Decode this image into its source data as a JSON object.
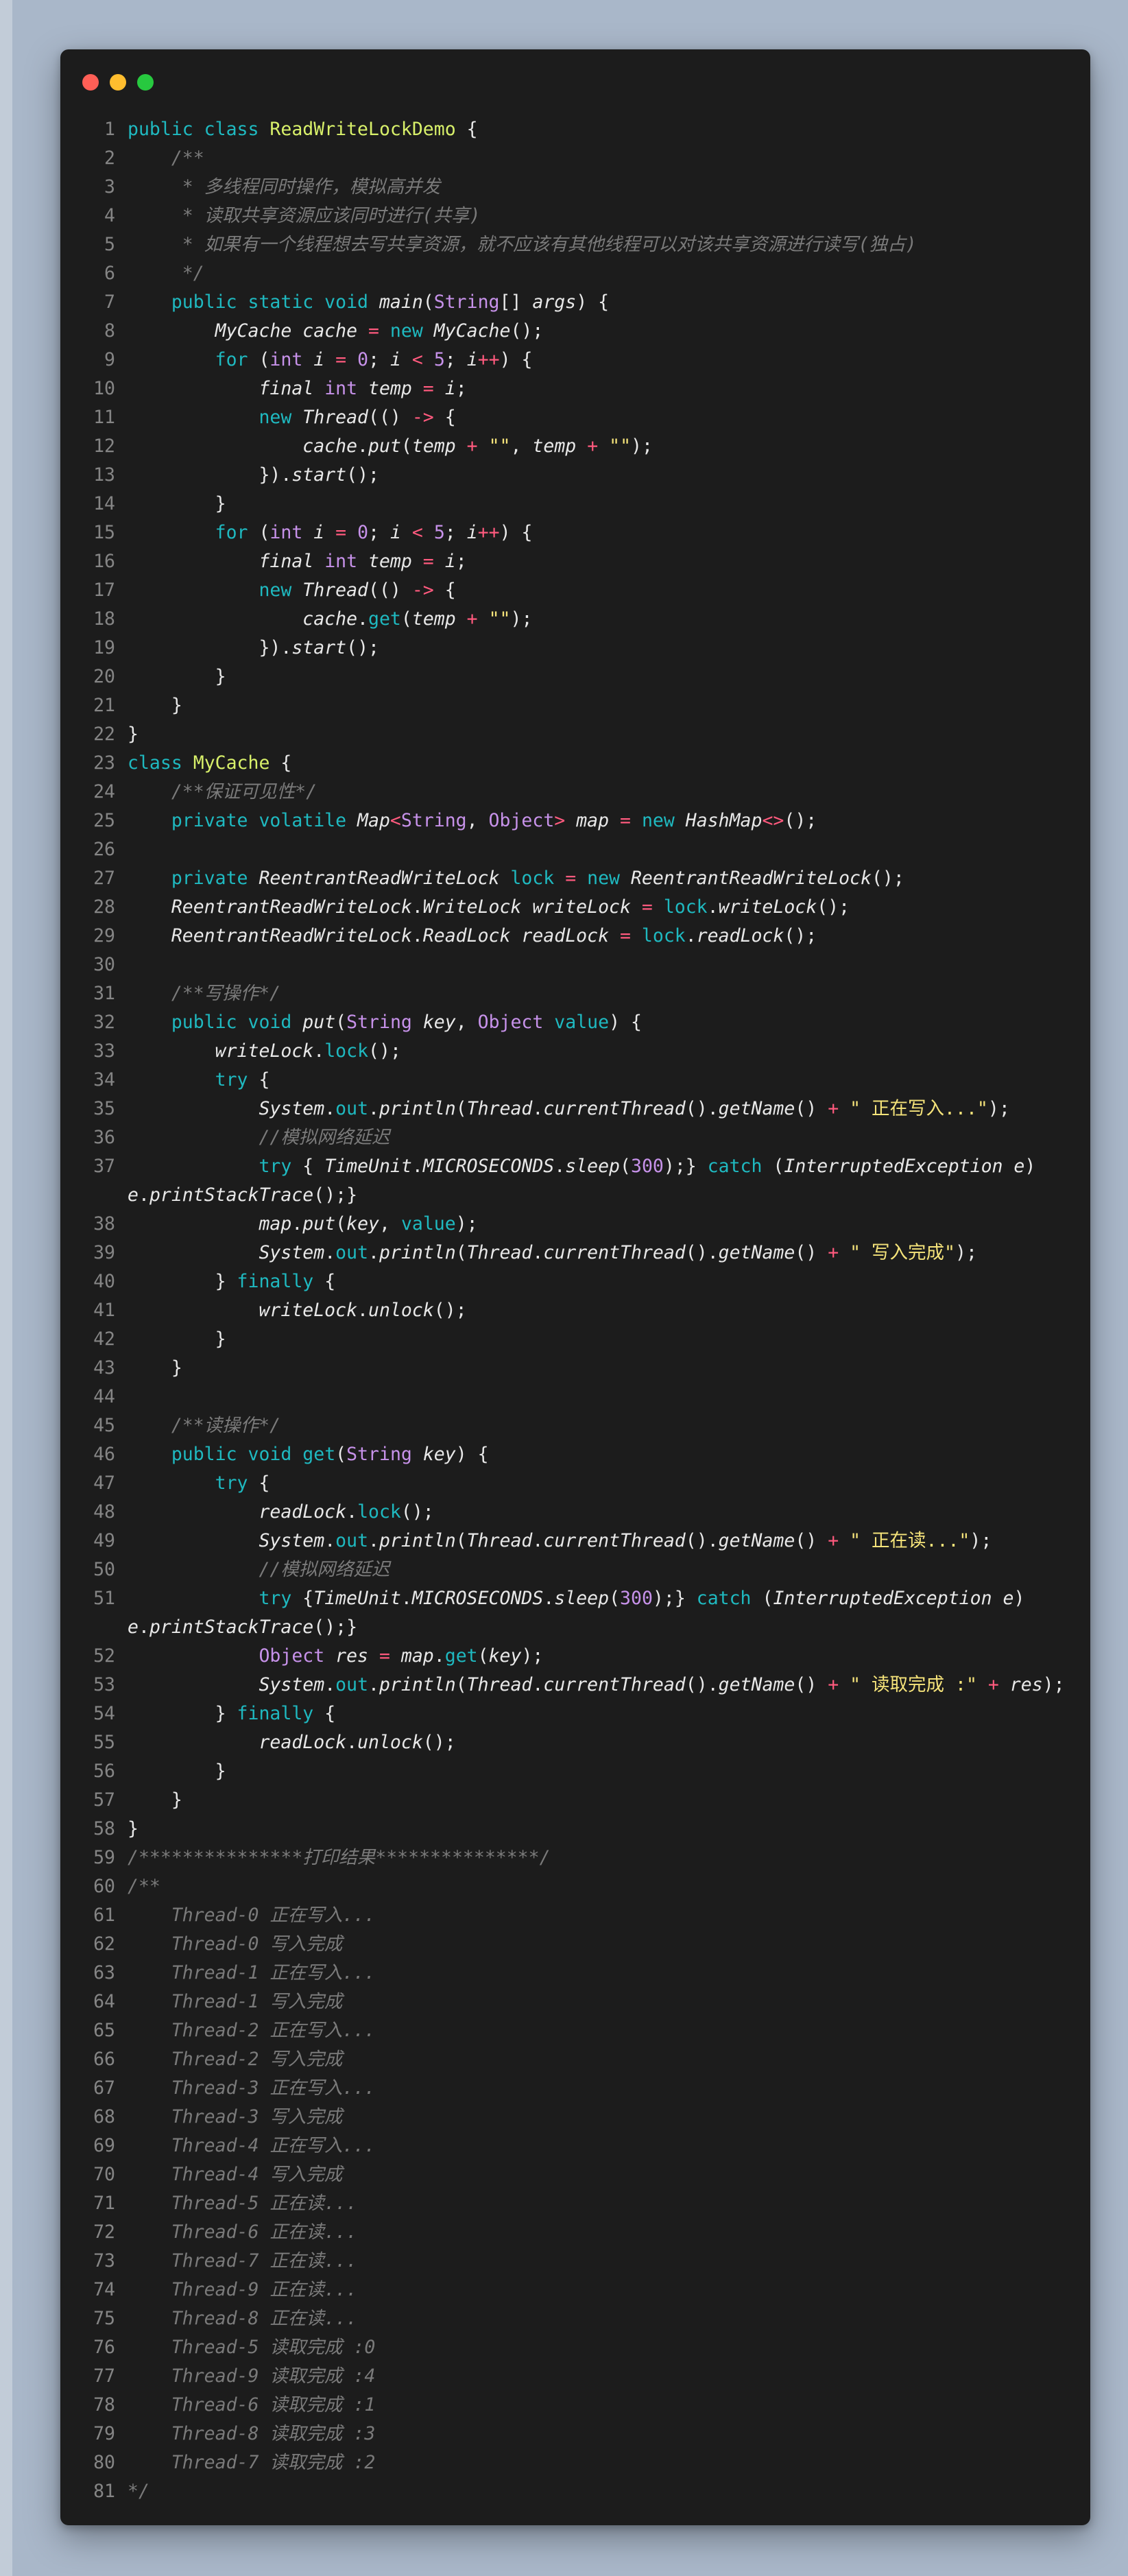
{
  "colors": {
    "background": "#a9b7c9",
    "window": "#1c1c1c",
    "close": "#ff5f56",
    "minimize": "#ffbd2e",
    "maximize": "#27c93f",
    "keyword": "#1fb9c0",
    "class_name": "#d8f06a",
    "type": "#c792ea",
    "operator": "#ff5a7e",
    "string": "#f5e37a",
    "comment": "#7a7a7a",
    "line_number": "#858585"
  },
  "window_controls": [
    "close-dot",
    "minimize-dot",
    "maximize-dot"
  ],
  "code_lines": [
    [
      [
        "k",
        "public class "
      ],
      [
        "cls",
        "ReadWriteLockDemo"
      ],
      [
        "pl",
        " {"
      ]
    ],
    [
      [
        "cm",
        "    /**"
      ]
    ],
    [
      [
        "cm",
        "     * 多线程同时操作，模拟高并发"
      ]
    ],
    [
      [
        "cm",
        "     * 读取共享资源应该同时进行(共享)"
      ]
    ],
    [
      [
        "cm",
        "     * 如果有一个线程想去写共享资源，就不应该有其他线程可以对该共享资源进行读写(独占)"
      ]
    ],
    [
      [
        "cm",
        "     */"
      ]
    ],
    [
      [
        "k",
        "    public static void "
      ],
      [
        "t",
        "main"
      ],
      [
        "pl",
        "("
      ],
      [
        "kp",
        "String"
      ],
      [
        "pl",
        "[] "
      ],
      [
        "t",
        "args"
      ],
      [
        "pl",
        ") {"
      ]
    ],
    [
      [
        "t",
        "        MyCache cache "
      ],
      [
        "op",
        "="
      ],
      [
        "k",
        " new "
      ],
      [
        "t",
        "MyCache"
      ],
      [
        "pl",
        "();"
      ]
    ],
    [
      [
        "k",
        "        for "
      ],
      [
        "pl",
        "("
      ],
      [
        "kp",
        "int "
      ],
      [
        "t",
        "i "
      ],
      [
        "op",
        "="
      ],
      [
        "num",
        " 0"
      ],
      [
        "pl",
        "; "
      ],
      [
        "t",
        "i "
      ],
      [
        "op",
        "<"
      ],
      [
        "num",
        " 5"
      ],
      [
        "pl",
        "; "
      ],
      [
        "t",
        "i"
      ],
      [
        "op",
        "++"
      ],
      [
        "pl",
        ") {"
      ]
    ],
    [
      [
        "t",
        "            final "
      ],
      [
        "kp",
        "int "
      ],
      [
        "t",
        "temp "
      ],
      [
        "op",
        "="
      ],
      [
        "t",
        " i"
      ],
      [
        "pl",
        ";"
      ]
    ],
    [
      [
        "k",
        "            new "
      ],
      [
        "t",
        "Thread"
      ],
      [
        "pl",
        "(() "
      ],
      [
        "op",
        "->"
      ],
      [
        "pl",
        " {"
      ]
    ],
    [
      [
        "t",
        "                cache"
      ],
      [
        "pl",
        "."
      ],
      [
        "t",
        "put"
      ],
      [
        "pl",
        "("
      ],
      [
        "t",
        "temp "
      ],
      [
        "op",
        "+"
      ],
      [
        "str",
        " \"\""
      ],
      [
        "pl",
        ", "
      ],
      [
        "t",
        "temp "
      ],
      [
        "op",
        "+"
      ],
      [
        "str",
        " \"\""
      ],
      [
        "pl",
        ");"
      ]
    ],
    [
      [
        "pl",
        "            })."
      ],
      [
        "t",
        "start"
      ],
      [
        "pl",
        "();"
      ]
    ],
    [
      [
        "pl",
        "        }"
      ]
    ],
    [
      [
        "k",
        "        for "
      ],
      [
        "pl",
        "("
      ],
      [
        "kp",
        "int "
      ],
      [
        "t",
        "i "
      ],
      [
        "op",
        "="
      ],
      [
        "num",
        " 0"
      ],
      [
        "pl",
        "; "
      ],
      [
        "t",
        "i "
      ],
      [
        "op",
        "<"
      ],
      [
        "num",
        " 5"
      ],
      [
        "pl",
        "; "
      ],
      [
        "t",
        "i"
      ],
      [
        "op",
        "++"
      ],
      [
        "pl",
        ") {"
      ]
    ],
    [
      [
        "t",
        "            final "
      ],
      [
        "kp",
        "int "
      ],
      [
        "t",
        "temp "
      ],
      [
        "op",
        "="
      ],
      [
        "t",
        " i"
      ],
      [
        "pl",
        ";"
      ]
    ],
    [
      [
        "k",
        "            new "
      ],
      [
        "t",
        "Thread"
      ],
      [
        "pl",
        "(() "
      ],
      [
        "op",
        "->"
      ],
      [
        "pl",
        " {"
      ]
    ],
    [
      [
        "t",
        "                cache"
      ],
      [
        "pl",
        "."
      ],
      [
        "fn",
        "get"
      ],
      [
        "pl",
        "("
      ],
      [
        "t",
        "temp "
      ],
      [
        "op",
        "+"
      ],
      [
        "str",
        " \"\""
      ],
      [
        "pl",
        ");"
      ]
    ],
    [
      [
        "pl",
        "            })."
      ],
      [
        "t",
        "start"
      ],
      [
        "pl",
        "();"
      ]
    ],
    [
      [
        "pl",
        "        }"
      ]
    ],
    [
      [
        "pl",
        "    }"
      ]
    ],
    [
      [
        "pl",
        "}"
      ]
    ],
    [
      [
        "k",
        "class "
      ],
      [
        "cls",
        "MyCache"
      ],
      [
        "pl",
        " {"
      ]
    ],
    [
      [
        "cm",
        "    /**保证可见性*/"
      ]
    ],
    [
      [
        "k",
        "    private volatile "
      ],
      [
        "t",
        "Map"
      ],
      [
        "op",
        "<"
      ],
      [
        "kp",
        "String"
      ],
      [
        "pl",
        ", "
      ],
      [
        "kp",
        "Object"
      ],
      [
        "op",
        ">"
      ],
      [
        "t",
        " map "
      ],
      [
        "op",
        "="
      ],
      [
        "k",
        " new "
      ],
      [
        "t",
        "HashMap"
      ],
      [
        "op",
        "<>"
      ],
      [
        "pl",
        "();"
      ]
    ],
    [
      [
        "pl",
        ""
      ]
    ],
    [
      [
        "k",
        "    private "
      ],
      [
        "t",
        "ReentrantReadWriteLock "
      ],
      [
        "fn",
        "lock"
      ],
      [
        "op",
        " ="
      ],
      [
        "k",
        " new "
      ],
      [
        "t",
        "ReentrantReadWriteLock"
      ],
      [
        "pl",
        "();"
      ]
    ],
    [
      [
        "t",
        "    ReentrantReadWriteLock"
      ],
      [
        "pl",
        "."
      ],
      [
        "t",
        "WriteLock writeLock "
      ],
      [
        "op",
        "="
      ],
      [
        "fn",
        " lock"
      ],
      [
        "pl",
        "."
      ],
      [
        "t",
        "writeLock"
      ],
      [
        "pl",
        "();"
      ]
    ],
    [
      [
        "t",
        "    ReentrantReadWriteLock"
      ],
      [
        "pl",
        "."
      ],
      [
        "t",
        "ReadLock readLock "
      ],
      [
        "op",
        "="
      ],
      [
        "fn",
        " lock"
      ],
      [
        "pl",
        "."
      ],
      [
        "t",
        "readLock"
      ],
      [
        "pl",
        "();"
      ]
    ],
    [
      [
        "pl",
        ""
      ]
    ],
    [
      [
        "cm",
        "    /**写操作*/"
      ]
    ],
    [
      [
        "k",
        "    public void "
      ],
      [
        "t",
        "put"
      ],
      [
        "pl",
        "("
      ],
      [
        "kp",
        "String "
      ],
      [
        "t",
        "key"
      ],
      [
        "pl",
        ", "
      ],
      [
        "kp",
        "Object "
      ],
      [
        "fn",
        "value"
      ],
      [
        "pl",
        ") {"
      ]
    ],
    [
      [
        "t",
        "        writeLock"
      ],
      [
        "pl",
        "."
      ],
      [
        "fn",
        "lock"
      ],
      [
        "pl",
        "();"
      ]
    ],
    [
      [
        "k",
        "        try"
      ],
      [
        "pl",
        " {"
      ]
    ],
    [
      [
        "t",
        "            System"
      ],
      [
        "pl",
        "."
      ],
      [
        "fn",
        "out"
      ],
      [
        "pl",
        "."
      ],
      [
        "t",
        "println"
      ],
      [
        "pl",
        "("
      ],
      [
        "t",
        "Thread"
      ],
      [
        "pl",
        "."
      ],
      [
        "t",
        "currentThread"
      ],
      [
        "pl",
        "()."
      ],
      [
        "t",
        "getName"
      ],
      [
        "pl",
        "() "
      ],
      [
        "op",
        "+"
      ],
      [
        "str",
        " \" 正在写入...\""
      ],
      [
        "pl",
        ");"
      ]
    ],
    [
      [
        "cm",
        "            //模拟网络延迟"
      ]
    ],
    [
      [
        "k",
        "            try"
      ],
      [
        "pl",
        " { "
      ],
      [
        "t",
        "TimeUnit"
      ],
      [
        "pl",
        "."
      ],
      [
        "t",
        "MICROSECONDS"
      ],
      [
        "pl",
        "."
      ],
      [
        "t",
        "sleep"
      ],
      [
        "pl",
        "("
      ],
      [
        "num",
        "300"
      ],
      [
        "pl",
        ");} "
      ],
      [
        "k",
        "catch"
      ],
      [
        "pl",
        " ("
      ],
      [
        "t",
        "InterruptedException e"
      ],
      [
        "pl",
        ")\n"
      ],
      [
        "t",
        "e"
      ],
      [
        "pl",
        "."
      ],
      [
        "t",
        "printStackTrace"
      ],
      [
        "pl",
        "();}"
      ]
    ],
    [
      [
        "t",
        "            map"
      ],
      [
        "pl",
        "."
      ],
      [
        "t",
        "put"
      ],
      [
        "pl",
        "("
      ],
      [
        "t",
        "key"
      ],
      [
        "pl",
        ", "
      ],
      [
        "fn",
        "value"
      ],
      [
        "pl",
        ");"
      ]
    ],
    [
      [
        "t",
        "            System"
      ],
      [
        "pl",
        "."
      ],
      [
        "fn",
        "out"
      ],
      [
        "pl",
        "."
      ],
      [
        "t",
        "println"
      ],
      [
        "pl",
        "("
      ],
      [
        "t",
        "Thread"
      ],
      [
        "pl",
        "."
      ],
      [
        "t",
        "currentThread"
      ],
      [
        "pl",
        "()."
      ],
      [
        "t",
        "getName"
      ],
      [
        "pl",
        "() "
      ],
      [
        "op",
        "+"
      ],
      [
        "str",
        " \" 写入完成\""
      ],
      [
        "pl",
        ");"
      ]
    ],
    [
      [
        "pl",
        "        } "
      ],
      [
        "k",
        "finally"
      ],
      [
        "pl",
        " {"
      ]
    ],
    [
      [
        "t",
        "            writeLock"
      ],
      [
        "pl",
        "."
      ],
      [
        "t",
        "unlock"
      ],
      [
        "pl",
        "();"
      ]
    ],
    [
      [
        "pl",
        "        }"
      ]
    ],
    [
      [
        "pl",
        "    }"
      ]
    ],
    [
      [
        "pl",
        ""
      ]
    ],
    [
      [
        "cm",
        "    /**读操作*/"
      ]
    ],
    [
      [
        "k",
        "    public void "
      ],
      [
        "fn",
        "get"
      ],
      [
        "pl",
        "("
      ],
      [
        "kp",
        "String "
      ],
      [
        "t",
        "key"
      ],
      [
        "pl",
        ") {"
      ]
    ],
    [
      [
        "k",
        "        try"
      ],
      [
        "pl",
        " {"
      ]
    ],
    [
      [
        "t",
        "            readLock"
      ],
      [
        "pl",
        "."
      ],
      [
        "fn",
        "lock"
      ],
      [
        "pl",
        "();"
      ]
    ],
    [
      [
        "t",
        "            System"
      ],
      [
        "pl",
        "."
      ],
      [
        "fn",
        "out"
      ],
      [
        "pl",
        "."
      ],
      [
        "t",
        "println"
      ],
      [
        "pl",
        "("
      ],
      [
        "t",
        "Thread"
      ],
      [
        "pl",
        "."
      ],
      [
        "t",
        "currentThread"
      ],
      [
        "pl",
        "()."
      ],
      [
        "t",
        "getName"
      ],
      [
        "pl",
        "() "
      ],
      [
        "op",
        "+"
      ],
      [
        "str",
        " \" 正在读...\""
      ],
      [
        "pl",
        ");"
      ]
    ],
    [
      [
        "cm",
        "            //模拟网络延迟"
      ]
    ],
    [
      [
        "k",
        "            try"
      ],
      [
        "pl",
        " {"
      ],
      [
        "t",
        "TimeUnit"
      ],
      [
        "pl",
        "."
      ],
      [
        "t",
        "MICROSECONDS"
      ],
      [
        "pl",
        "."
      ],
      [
        "t",
        "sleep"
      ],
      [
        "pl",
        "("
      ],
      [
        "num",
        "300"
      ],
      [
        "pl",
        ");} "
      ],
      [
        "k",
        "catch"
      ],
      [
        "pl",
        " ("
      ],
      [
        "t",
        "InterruptedException e"
      ],
      [
        "pl",
        ")\n"
      ],
      [
        "t",
        "e"
      ],
      [
        "pl",
        "."
      ],
      [
        "t",
        "printStackTrace"
      ],
      [
        "pl",
        "();}"
      ]
    ],
    [
      [
        "kp",
        "            Object "
      ],
      [
        "t",
        "res "
      ],
      [
        "op",
        "="
      ],
      [
        "t",
        " map"
      ],
      [
        "pl",
        "."
      ],
      [
        "fn",
        "get"
      ],
      [
        "pl",
        "("
      ],
      [
        "t",
        "key"
      ],
      [
        "pl",
        ");"
      ]
    ],
    [
      [
        "t",
        "            System"
      ],
      [
        "pl",
        "."
      ],
      [
        "fn",
        "out"
      ],
      [
        "pl",
        "."
      ],
      [
        "t",
        "println"
      ],
      [
        "pl",
        "("
      ],
      [
        "t",
        "Thread"
      ],
      [
        "pl",
        "."
      ],
      [
        "t",
        "currentThread"
      ],
      [
        "pl",
        "()."
      ],
      [
        "t",
        "getName"
      ],
      [
        "pl",
        "() "
      ],
      [
        "op",
        "+"
      ],
      [
        "str",
        " \" 读取完成 :\""
      ],
      [
        "op",
        " +"
      ],
      [
        "t",
        " res"
      ],
      [
        "pl",
        ");"
      ]
    ],
    [
      [
        "pl",
        "        } "
      ],
      [
        "k",
        "finally"
      ],
      [
        "pl",
        " {"
      ]
    ],
    [
      [
        "t",
        "            readLock"
      ],
      [
        "pl",
        "."
      ],
      [
        "t",
        "unlock"
      ],
      [
        "pl",
        "();"
      ]
    ],
    [
      [
        "pl",
        "        }"
      ]
    ],
    [
      [
        "pl",
        "    }"
      ]
    ],
    [
      [
        "pl",
        "}"
      ]
    ],
    [
      [
        "cm",
        "/***************打印结果***************/"
      ]
    ],
    [
      [
        "cm",
        "/**"
      ]
    ],
    [
      [
        "cm",
        "    Thread-0 正在写入..."
      ]
    ],
    [
      [
        "cm",
        "    Thread-0 写入完成"
      ]
    ],
    [
      [
        "cm",
        "    Thread-1 正在写入..."
      ]
    ],
    [
      [
        "cm",
        "    Thread-1 写入完成"
      ]
    ],
    [
      [
        "cm",
        "    Thread-2 正在写入..."
      ]
    ],
    [
      [
        "cm",
        "    Thread-2 写入完成"
      ]
    ],
    [
      [
        "cm",
        "    Thread-3 正在写入..."
      ]
    ],
    [
      [
        "cm",
        "    Thread-3 写入完成"
      ]
    ],
    [
      [
        "cm",
        "    Thread-4 正在写入..."
      ]
    ],
    [
      [
        "cm",
        "    Thread-4 写入完成"
      ]
    ],
    [
      [
        "cm",
        "    Thread-5 正在读..."
      ]
    ],
    [
      [
        "cm",
        "    Thread-6 正在读..."
      ]
    ],
    [
      [
        "cm",
        "    Thread-7 正在读..."
      ]
    ],
    [
      [
        "cm",
        "    Thread-9 正在读..."
      ]
    ],
    [
      [
        "cm",
        "    Thread-8 正在读..."
      ]
    ],
    [
      [
        "cm",
        "    Thread-5 读取完成 :0"
      ]
    ],
    [
      [
        "cm",
        "    Thread-9 读取完成 :4"
      ]
    ],
    [
      [
        "cm",
        "    Thread-6 读取完成 :1"
      ]
    ],
    [
      [
        "cm",
        "    Thread-8 读取完成 :3"
      ]
    ],
    [
      [
        "cm",
        "    Thread-7 读取完成 :2"
      ]
    ],
    [
      [
        "cm",
        "*/"
      ]
    ]
  ]
}
